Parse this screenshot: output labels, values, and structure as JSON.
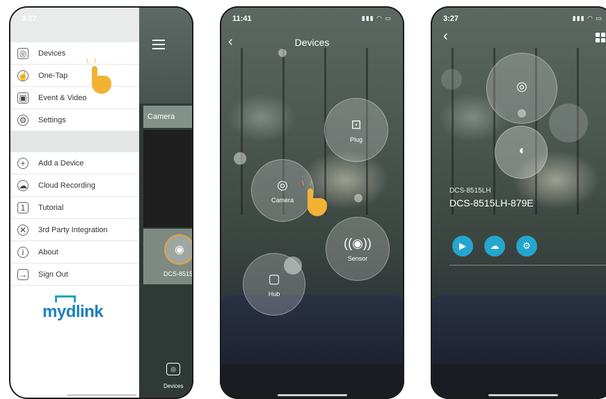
{
  "phone1": {
    "status_time": "3:27",
    "menu": {
      "primary": [
        {
          "label": "Devices",
          "icon": "devices-icon"
        },
        {
          "label": "One-Tap",
          "icon": "one-tap-icon"
        },
        {
          "label": "Event & Video",
          "icon": "event-video-icon"
        },
        {
          "label": "Settings",
          "icon": "gear-icon"
        }
      ],
      "secondary": [
        {
          "label": "Add a Device",
          "icon": "plus-circle-icon"
        },
        {
          "label": "Cloud Recording",
          "icon": "cloud-icon"
        },
        {
          "label": "Tutorial",
          "icon": "tutorial-icon"
        },
        {
          "label": "3rd Party Integration",
          "icon": "handshake-icon"
        },
        {
          "label": "About",
          "icon": "info-icon"
        },
        {
          "label": "Sign Out",
          "icon": "sign-out-icon"
        }
      ]
    },
    "logo": "mydlink",
    "right_pane": {
      "tab_label": "Camera",
      "device_label": "DCS-8515",
      "bottom_label": "Devices"
    }
  },
  "phone2": {
    "status_time": "11:41",
    "title": "Devices",
    "bubbles": [
      {
        "label": "Plug",
        "icon": "plug-icon"
      },
      {
        "label": "Camera",
        "icon": "camera-icon"
      },
      {
        "label": "Sensor",
        "icon": "sensor-icon"
      },
      {
        "label": "Hub",
        "icon": "hub-icon"
      }
    ]
  },
  "phone3": {
    "status_time": "3:27",
    "model": "DCS-8515LH",
    "device_name": "DCS-8515LH-879E",
    "actions": [
      {
        "icon": "video-icon"
      },
      {
        "icon": "cloud-icon"
      },
      {
        "icon": "gear-icon"
      }
    ]
  },
  "colors": {
    "accent": "#24a6cf",
    "highlight": "#e8a23b",
    "logo": "#1d7fbf"
  }
}
